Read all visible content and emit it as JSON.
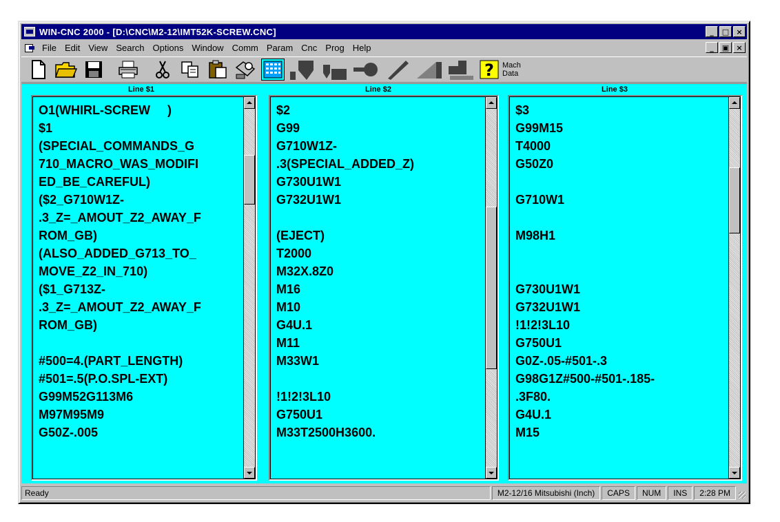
{
  "window": {
    "title": "WIN-CNC 2000 - [D:\\CNC\\M2-12\\IMT52K-SCREW.CNC]",
    "minimize": "_",
    "maximize": "□",
    "close": "×",
    "restore": "▣"
  },
  "menu": [
    "File",
    "Edit",
    "View",
    "Search",
    "Options",
    "Window",
    "Comm",
    "Param",
    "Cnc",
    "Prog",
    "Help"
  ],
  "toolbar": {
    "mach_line1": "Mach",
    "mach_line2": "Data",
    "help_glyph": "?"
  },
  "panes": [
    {
      "title": "Line $1",
      "scroll_position": 0.15,
      "lines": [
        "O1(WHIRL-SCREW     )",
        "$1",
        "(SPECIAL_COMMANDS_G",
        "710_MACRO_WAS_MODIFI",
        "ED_BE_CAREFUL)",
        "($2_G710W1Z-",
        ".3_Z=_AMOUT_Z2_AWAY_F",
        "ROM_GB)",
        "(ALSO_ADDED_G713_TO_",
        "MOVE_Z2_IN_710)",
        "($1_G713Z-",
        ".3_Z=_AMOUT_Z2_AWAY_F",
        "ROM_GB)",
        "",
        "#500=4.(PART_LENGTH)",
        "#501=.5(P.O.SPL-EXT)",
        "G99M52G113M6",
        "M97M95M9",
        "G50Z-.005"
      ]
    },
    {
      "title": "Line $2",
      "scroll_position": 0.5,
      "lines": [
        "$2",
        "G99",
        "G710W1Z-",
        ".3(SPECIAL_ADDED_Z)",
        "G730U1W1",
        "G732U1W1",
        "",
        "(EJECT)",
        "T2000",
        "M32X.8Z0",
        "M16",
        "M10",
        "G4U.1",
        "M11",
        "M33W1",
        "",
        "!1!2!3L10",
        "G750U1",
        "M33T2500H3600."
      ]
    },
    {
      "title": "Line $3",
      "scroll_position": 0.2,
      "lines": [
        "$3",
        "G99M15",
        "T4000",
        "G50Z0",
        "",
        "G710W1",
        "",
        "M98H1",
        "",
        "",
        "G730U1W1",
        "G732U1W1",
        "!1!2!3L10",
        "G750U1",
        "G0Z-.05-#501-.3",
        "G98G1Z#500-#501-.185-",
        ".3F80.",
        "G4U.1",
        "M15"
      ]
    }
  ],
  "status": {
    "message": "Ready",
    "machine": "M2-12/16 Mitsubishi (Inch)",
    "caps": "CAPS",
    "num": "NUM",
    "ins": "INS",
    "time": "2:28 PM"
  }
}
